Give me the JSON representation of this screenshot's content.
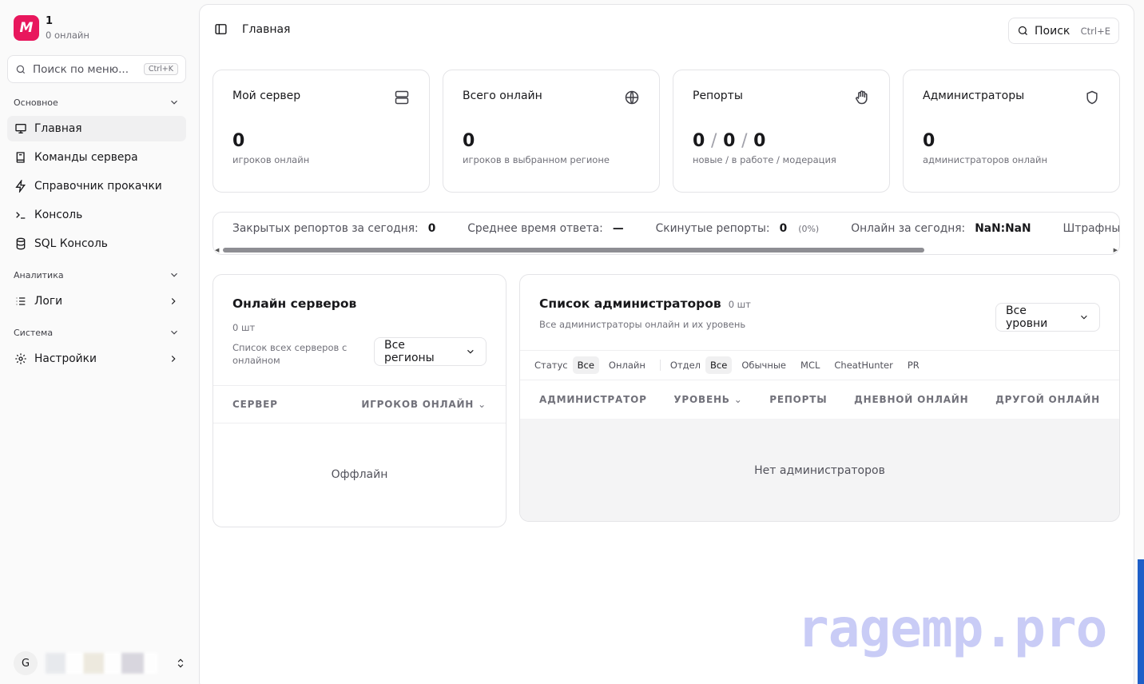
{
  "brand": {
    "logo": "M",
    "name": "1",
    "status": "0 онлайн",
    "color": "#e8175d"
  },
  "sidebar": {
    "search_placeholder": "Поиск по меню...",
    "search_kbd": "Ctrl+K",
    "groups": [
      {
        "label": "Основное"
      },
      {
        "label": "Аналитика"
      },
      {
        "label": "Система"
      }
    ],
    "items": [
      {
        "label": "Главная",
        "icon": "monitor-icon",
        "active": true
      },
      {
        "label": "Команды сервера",
        "icon": "book-icon"
      },
      {
        "label": "Справочник прокачки",
        "icon": "zap-icon"
      },
      {
        "label": "Консоль",
        "icon": "terminal-icon"
      },
      {
        "label": "SQL Консоль",
        "icon": "database-icon"
      },
      {
        "label": "Логи",
        "icon": "list-icon"
      },
      {
        "label": "Настройки",
        "icon": "gear-icon"
      }
    ],
    "user_initial": "G"
  },
  "header": {
    "title": "Главная",
    "search_label": "Поиск",
    "search_kbd": "Ctrl+E"
  },
  "stats": [
    {
      "title": "Мой сервер",
      "value": "0",
      "sub": "игроков онлайн",
      "icon": "server-icon"
    },
    {
      "title": "Всего онлайн",
      "value": "0",
      "sub": "игроков в выбранном регионе",
      "icon": "globe-icon"
    },
    {
      "title": "Репорты",
      "values": [
        "0",
        "0",
        "0"
      ],
      "sub": "новые / в работе / модерация",
      "icon": "hand-icon"
    },
    {
      "title": "Администраторы",
      "value": "0",
      "sub": "администраторов онлайн",
      "icon": "shield-icon"
    }
  ],
  "strip": {
    "closed_label": "Закрытых репортов за сегодня:",
    "closed_value": "0",
    "avg_label": "Среднее время ответа:",
    "avg_value": "—",
    "skipped_label": "Скинутые репорты:",
    "skipped_value": "0",
    "skipped_pct": "(0%)",
    "online_label": "Онлайн за сегодня:",
    "online_value": "NaN:NaN",
    "penalty_label": "Штрафные"
  },
  "servers": {
    "title": "Онлайн серверов",
    "count": "0 шт",
    "desc": "Список всех серверов с онлайном",
    "region_select": "Все регионы",
    "col_server": "СЕРВЕР",
    "col_players": "ИГРОКОВ ОНЛАЙН",
    "empty": "Оффлайн"
  },
  "admins": {
    "title": "Список администраторов",
    "count": "0 шт",
    "desc": "Все администраторы онлайн и их уровень",
    "level_select": "Все уровни",
    "status_label": "Статус",
    "status_filters": [
      "Все",
      "Онлайн"
    ],
    "dept_label": "Отдел",
    "dept_filters": [
      "Все",
      "Обычные",
      "MCL",
      "CheatHunter",
      "PR"
    ],
    "columns": [
      "АДМИНИСТРАТОР",
      "УРОВЕНЬ",
      "РЕПОРТЫ",
      "ДНЕВНОЙ ОНЛАЙН",
      "ДРУГОЙ ОНЛАЙН"
    ],
    "empty": "Нет администраторов"
  },
  "watermark": "ragemp.pro"
}
